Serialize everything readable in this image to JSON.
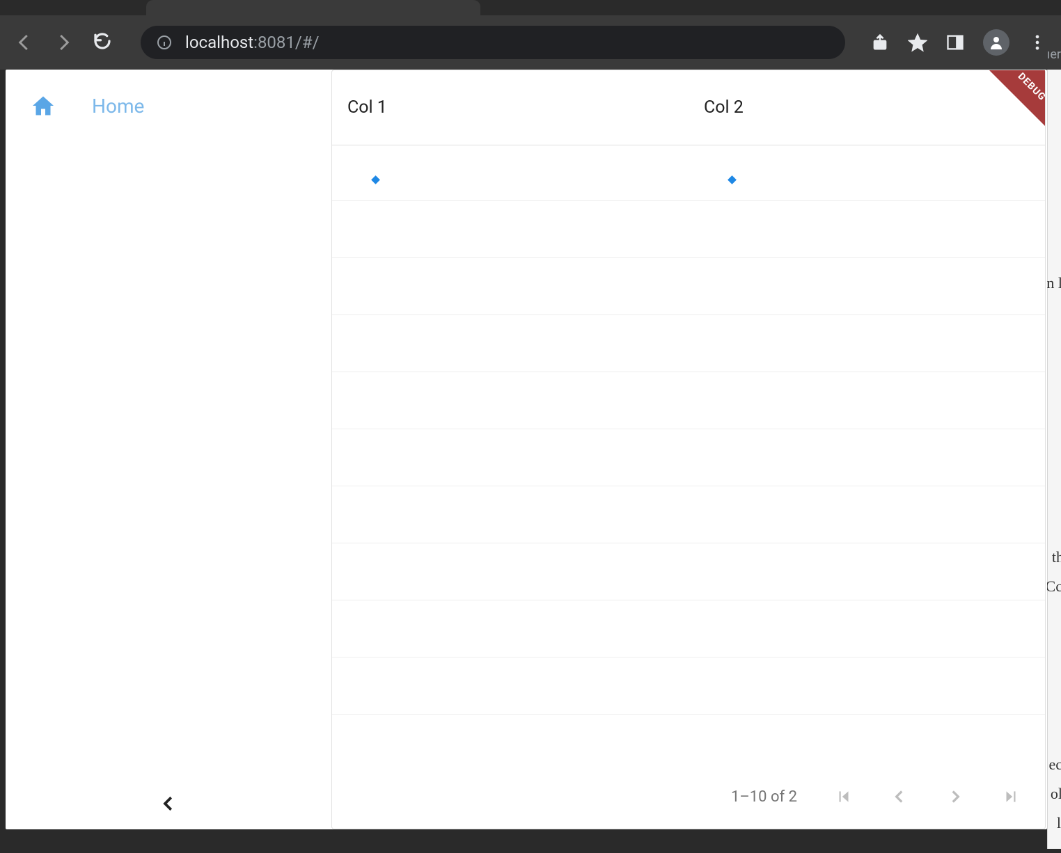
{
  "browser": {
    "url_host": "localhost",
    "url_port_path": ":8081/#/"
  },
  "sidebar": {
    "items": [
      {
        "label": "Home"
      }
    ]
  },
  "debug_banner": "DEBUG",
  "table": {
    "columns": [
      "Col 1",
      "Col 2"
    ],
    "rows": [
      {
        "c1": "",
        "c2": "",
        "marker": true
      },
      {
        "c1": "",
        "c2": ""
      },
      {
        "c1": "",
        "c2": ""
      },
      {
        "c1": "",
        "c2": ""
      },
      {
        "c1": "",
        "c2": ""
      },
      {
        "c1": "",
        "c2": ""
      },
      {
        "c1": "",
        "c2": ""
      },
      {
        "c1": "",
        "c2": ""
      },
      {
        "c1": "",
        "c2": ""
      },
      {
        "c1": "",
        "c2": ""
      }
    ],
    "pagination": "1–10 of 2"
  },
  "fragments": {
    "a": "ıer",
    "b": "n l",
    "c": "th",
    "d": "Cc",
    "e": "ec",
    "f": "ol",
    "g": " l "
  }
}
